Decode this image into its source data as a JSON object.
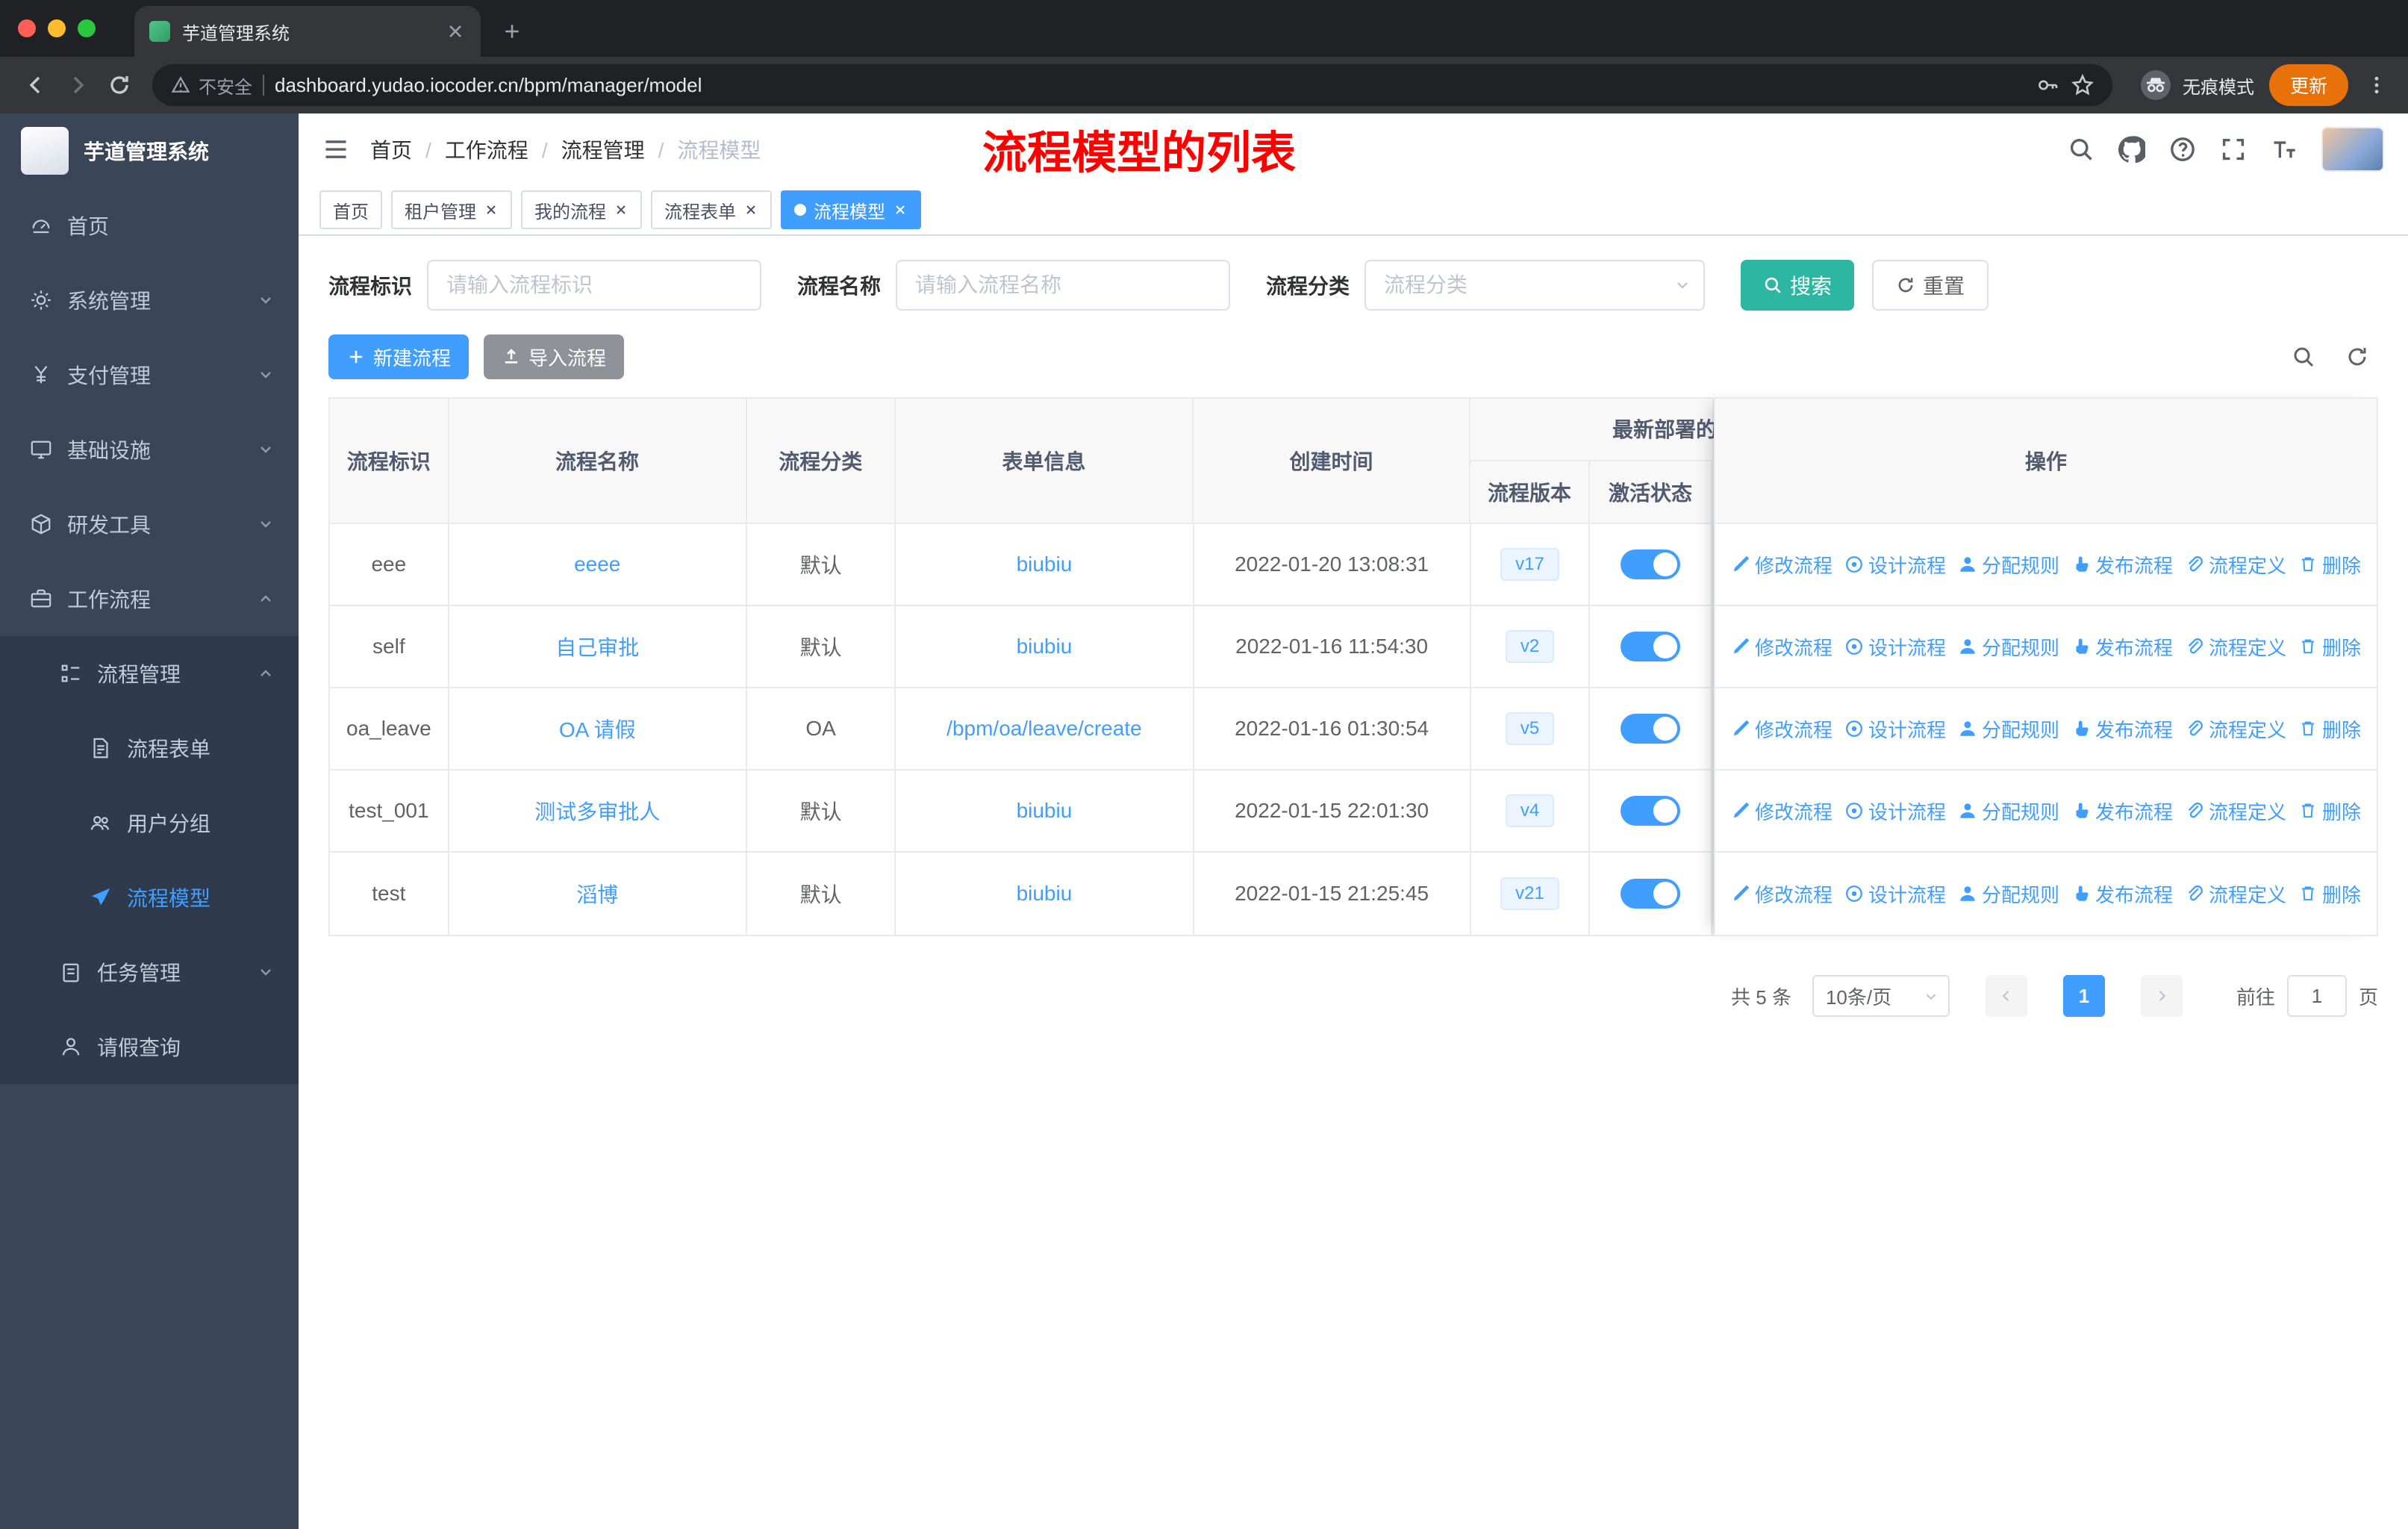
{
  "browser": {
    "tab_title": "芋道管理系统",
    "security_label": "不安全",
    "url": "dashboard.yudao.iocoder.cn/bpm/manager/model",
    "incognito_label": "无痕模式",
    "update_label": "更新"
  },
  "sidebar": {
    "logo_title": "芋道管理系统",
    "items": {
      "home": "首页",
      "system": "系统管理",
      "payment": "支付管理",
      "infra": "基础设施",
      "devtools": "研发工具",
      "workflow": "工作流程",
      "process_mgmt": "流程管理",
      "process_form": "流程表单",
      "user_group": "用户分组",
      "process_model": "流程模型",
      "task_mgmt": "任务管理",
      "leave_query": "请假查询"
    }
  },
  "header": {
    "breadcrumb": [
      "首页",
      "工作流程",
      "流程管理",
      "流程模型"
    ],
    "annotation": "流程模型的列表"
  },
  "tags": [
    {
      "label": "首页"
    },
    {
      "label": "租户管理"
    },
    {
      "label": "我的流程"
    },
    {
      "label": "流程表单"
    },
    {
      "label": "流程模型"
    }
  ],
  "filters": {
    "id_label": "流程标识",
    "id_placeholder": "请输入流程标识",
    "name_label": "流程名称",
    "name_placeholder": "请输入流程名称",
    "category_label": "流程分类",
    "category_placeholder": "流程分类",
    "search_label": "搜索",
    "reset_label": "重置"
  },
  "toolbar": {
    "create_label": "新建流程",
    "import_label": "导入流程"
  },
  "table": {
    "columns": [
      "流程标识",
      "流程名称",
      "流程分类",
      "表单信息",
      "创建时间"
    ],
    "group_label": "最新部署的",
    "sub_columns": [
      "流程版本",
      "激活状态"
    ],
    "action_column": "操作",
    "actions": [
      "修改流程",
      "设计流程",
      "分配规则",
      "发布流程",
      "流程定义",
      "删除"
    ],
    "rows": [
      {
        "id": "eee",
        "name": "eeee",
        "category": "默认",
        "form": "biubiu",
        "created": "2022-01-20 13:08:31",
        "version": "v17",
        "active": true
      },
      {
        "id": "self",
        "name": "自己审批",
        "category": "默认",
        "form": "biubiu",
        "created": "2022-01-16 11:54:30",
        "version": "v2",
        "active": true
      },
      {
        "id": "oa_leave",
        "name": "OA 请假",
        "category": "OA",
        "form": "/bpm/oa/leave/create",
        "created": "2022-01-16 01:30:54",
        "version": "v5",
        "active": true
      },
      {
        "id": "test_001",
        "name": "测试多审批人",
        "category": "默认",
        "form": "biubiu",
        "created": "2022-01-15 22:01:30",
        "version": "v4",
        "active": true
      },
      {
        "id": "test",
        "name": "滔博",
        "category": "默认",
        "form": "biubiu",
        "created": "2022-01-15 21:25:45",
        "version": "v21",
        "active": true
      }
    ]
  },
  "pagination": {
    "total_label": "共 5 条",
    "page_size": "10条/页",
    "current_page": "1",
    "goto_label": "前往",
    "goto_value": "1",
    "page_suffix": "页"
  },
  "icons": {
    "tab_favicon": "green-app-glyph",
    "security": "warning-triangle",
    "browser_right": [
      "key",
      "star",
      "incognito",
      "kebab-menu"
    ],
    "header_right": [
      "search",
      "github",
      "question",
      "fullscreen",
      "font-size",
      "avatar"
    ],
    "row_actions": [
      "pencil",
      "design-target",
      "user",
      "publish-hand",
      "paperclip",
      "trash"
    ]
  },
  "colors": {
    "primary": "#409EFF",
    "search_button": "#2DB7A3",
    "import_button": "#8F9399",
    "annotation": "#FF0000",
    "sidebar_bg": "#3A4558",
    "sidebar_sub_bg": "#2F3A4C"
  }
}
